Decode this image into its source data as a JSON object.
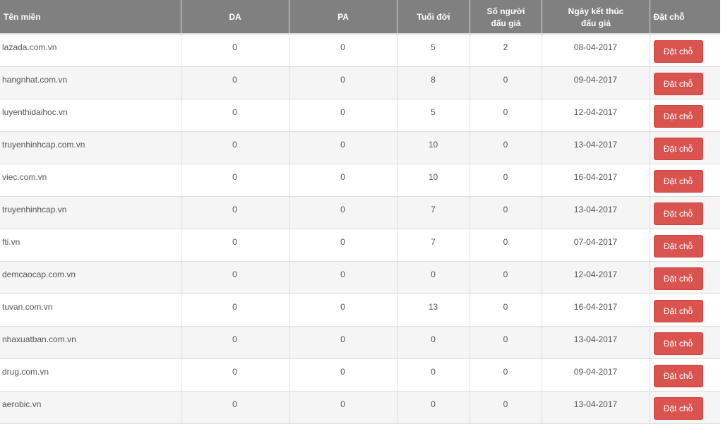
{
  "table": {
    "headers": {
      "domain": "Tên miền",
      "da": "DA",
      "pa": "PA",
      "age": "Tuổi đời",
      "bidders_line1": "Số người",
      "bidders_line2": "đấu giá",
      "end_date_line1": "Ngày kết thúc",
      "end_date_line2": "đấu giá",
      "reserve": "Đặt chỗ"
    },
    "reserve_button_label": "Đặt chỗ",
    "accent_color": "#d9534f",
    "header_color": "#808080",
    "rows": [
      {
        "domain": "lazada.com.vn",
        "da": "0",
        "pa": "0",
        "age": "5",
        "bidders": "2",
        "end_date": "08-04-2017",
        "action": "Đặt chỗ"
      },
      {
        "domain": "hangnhat.com.vn",
        "da": "0",
        "pa": "0",
        "age": "8",
        "bidders": "0",
        "end_date": "09-04-2017",
        "action": "Đặt chỗ"
      },
      {
        "domain": "luyenthidaihoc.vn",
        "da": "0",
        "pa": "0",
        "age": "5",
        "bidders": "0",
        "end_date": "12-04-2017",
        "action": "Đặt chỗ"
      },
      {
        "domain": "truyenhinhcap.com.vn",
        "da": "0",
        "pa": "0",
        "age": "10",
        "bidders": "0",
        "end_date": "13-04-2017",
        "action": "Đặt chỗ"
      },
      {
        "domain": "viec.com.vn",
        "da": "0",
        "pa": "0",
        "age": "10",
        "bidders": "0",
        "end_date": "16-04-2017",
        "action": "Đặt chỗ"
      },
      {
        "domain": "truyenhinhcap.vn",
        "da": "0",
        "pa": "0",
        "age": "7",
        "bidders": "0",
        "end_date": "13-04-2017",
        "action": "Đặt chỗ"
      },
      {
        "domain": "fti.vn",
        "da": "0",
        "pa": "0",
        "age": "7",
        "bidders": "0",
        "end_date": "07-04-2017",
        "action": "Đặt chỗ"
      },
      {
        "domain": "demcaocap.com.vn",
        "da": "0",
        "pa": "0",
        "age": "0",
        "bidders": "0",
        "end_date": "12-04-2017",
        "action": "Đặt chỗ"
      },
      {
        "domain": "tuvan.com.vn",
        "da": "0",
        "pa": "0",
        "age": "13",
        "bidders": "0",
        "end_date": "16-04-2017",
        "action": "Đặt chỗ"
      },
      {
        "domain": "nhaxuatban.com.vn",
        "da": "0",
        "pa": "0",
        "age": "0",
        "bidders": "0",
        "end_date": "13-04-2017",
        "action": "Đặt chỗ"
      },
      {
        "domain": "drug.com.vn",
        "da": "0",
        "pa": "0",
        "age": "0",
        "bidders": "0",
        "end_date": "09-04-2017",
        "action": "Đặt chỗ"
      },
      {
        "domain": "aerobic.vn",
        "da": "0",
        "pa": "0",
        "age": "0",
        "bidders": "0",
        "end_date": "13-04-2017",
        "action": "Đặt chỗ"
      }
    ]
  }
}
